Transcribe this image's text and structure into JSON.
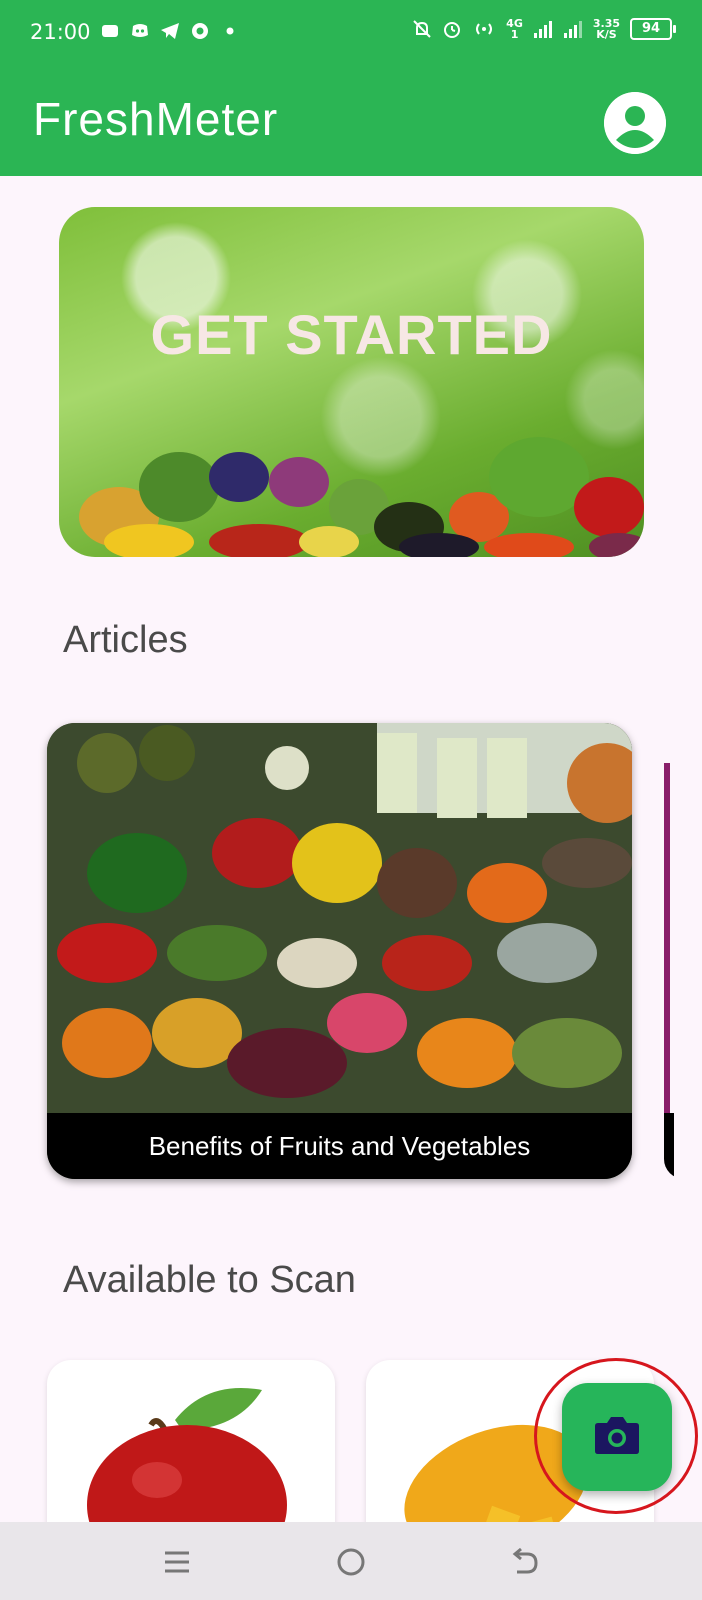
{
  "status_bar": {
    "time": "21:00",
    "network_top": "4G",
    "network_bottom": "1",
    "speed_top": "3.35",
    "speed_bottom": "K/S",
    "battery": "94"
  },
  "app_bar": {
    "title": "FreshMeter"
  },
  "banner": {
    "text": "GET STARTED"
  },
  "articles": {
    "title": "Articles",
    "items": [
      {
        "caption": "Benefits of Fruits and Vegetables"
      }
    ]
  },
  "scan": {
    "title": "Available to Scan",
    "items": [
      {
        "icon": "apple-image"
      },
      {
        "icon": "mango-image"
      }
    ]
  },
  "fab": {
    "icon": "camera-icon"
  },
  "nav_bar": {
    "icons": [
      "menu-icon",
      "home-icon",
      "back-icon"
    ]
  }
}
